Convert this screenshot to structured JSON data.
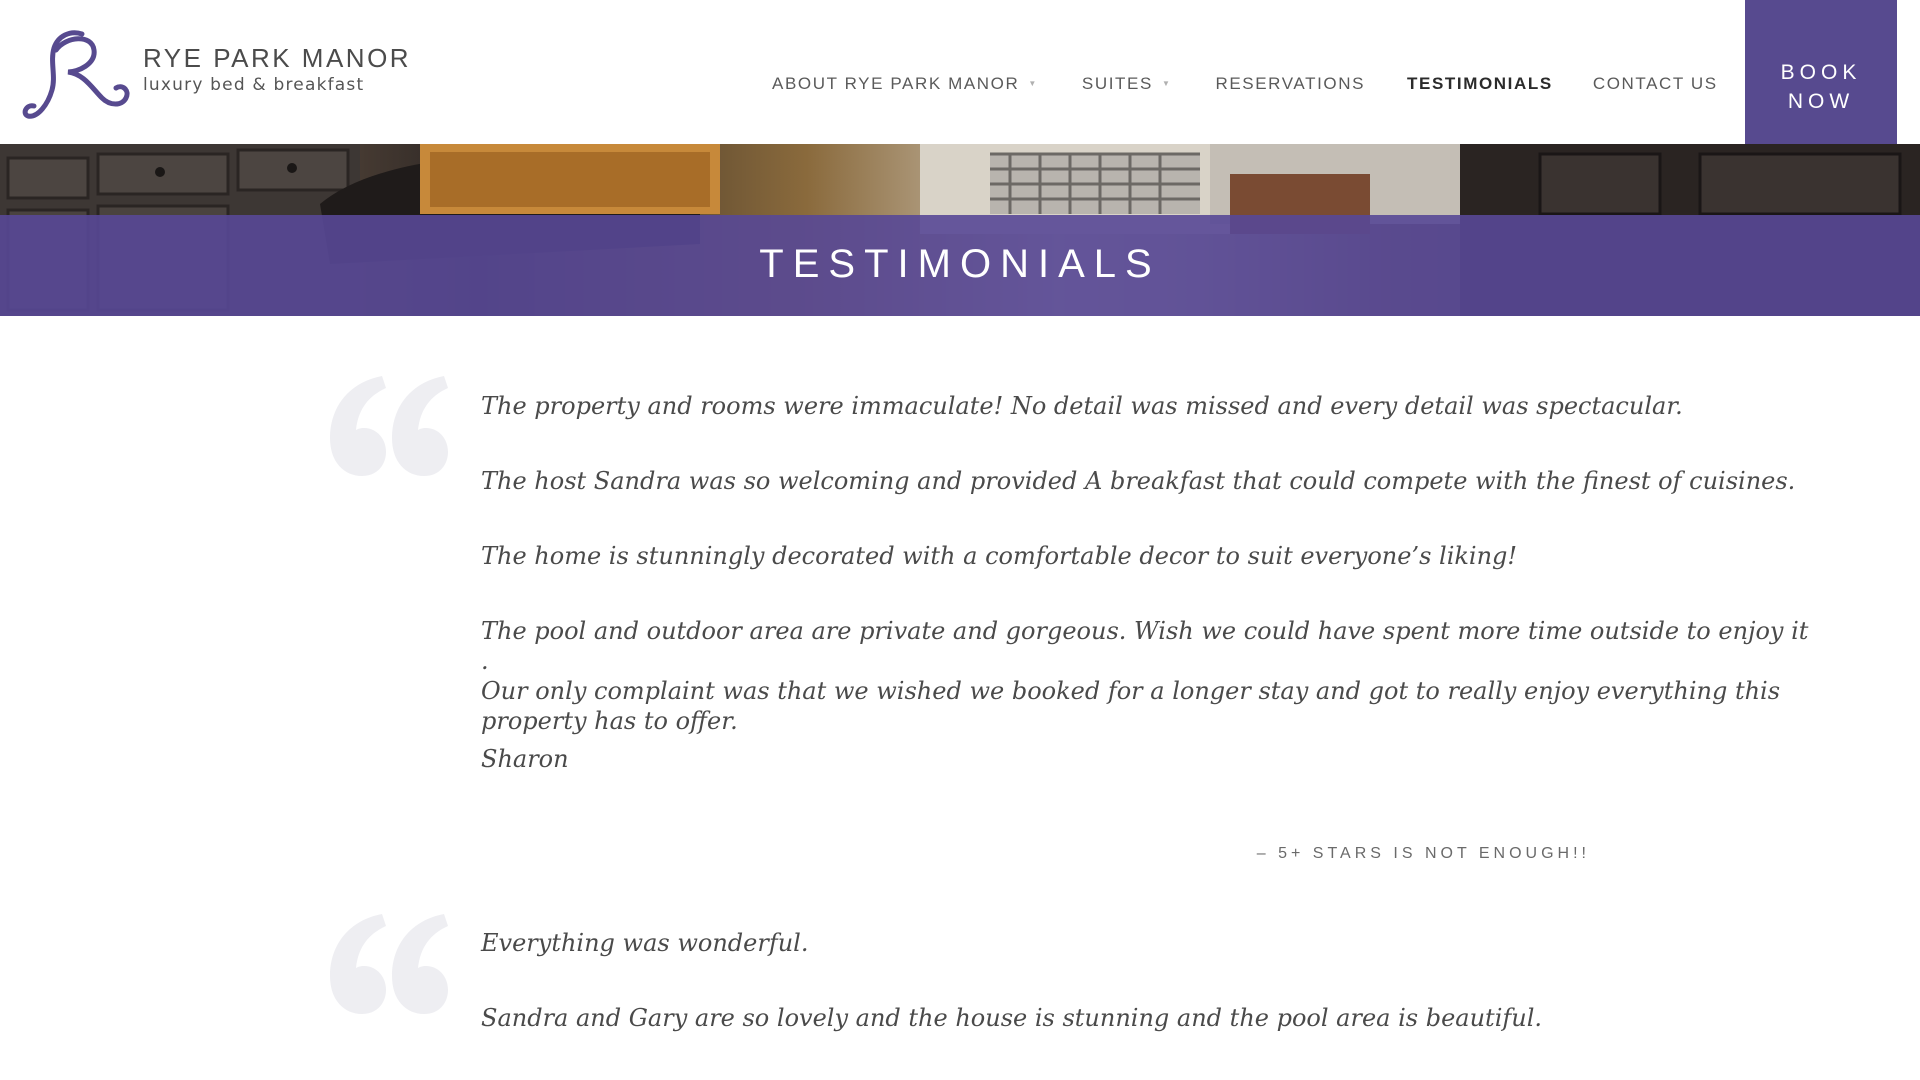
{
  "brand": {
    "name": "RYE PARK MANOR",
    "tagline": "luxury bed & breakfast",
    "accent_color": "#574a8f"
  },
  "nav": {
    "items": [
      {
        "label": "ABOUT RYE PARK MANOR",
        "has_dropdown": true
      },
      {
        "label": "SUITES",
        "has_dropdown": true
      },
      {
        "label": "RESERVATIONS",
        "has_dropdown": false
      },
      {
        "label": "TESTIMONIALS",
        "has_dropdown": false,
        "active": true
      },
      {
        "label": "CONTACT US",
        "has_dropdown": false
      }
    ],
    "book_now": {
      "line1": "BOOK",
      "line2": "NOW"
    }
  },
  "banner": {
    "title": "TESTIMONIALS"
  },
  "testimonials": [
    {
      "lines": [
        "The property and rooms were immaculate! No detail was missed and every detail was spectacular.",
        "The host Sandra was so welcoming and provided A breakfast that could compete with the finest of cuisines.",
        "The home is stunningly decorated with a comfortable decor to suit everyone’s liking!",
        "The pool and outdoor area are private and gorgeous. Wish we could have spent more time outside to enjoy it",
        ".",
        "Our only complaint was that we wished we booked for a longer stay and got to really enjoy everything this",
        "property has to offer.",
        "Sharon"
      ],
      "attribution": "– 5+ STARS IS NOT ENOUGH!!"
    },
    {
      "lines": [
        "Everything was wonderful.",
        "Sandra and Gary are so lovely and the house is stunning and the pool area is beautiful."
      ]
    }
  ]
}
